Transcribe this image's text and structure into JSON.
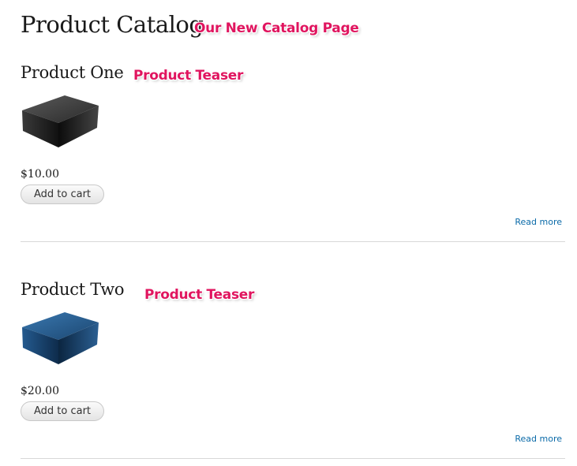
{
  "page": {
    "title": "Product Catalog",
    "title_annotation": "Our New Catalog Page"
  },
  "colors": {
    "annotation": "#e0155f",
    "link": "#0a6aa8",
    "divider": "#d8d8d8"
  },
  "products": [
    {
      "name": "Product One",
      "annotation": "Product Teaser",
      "image_icon": "black-box-image",
      "image_color": "#2b2b2b",
      "price": "$10.00",
      "cart_label": "Add to cart",
      "read_more": "Read more"
    },
    {
      "name": "Product Two",
      "annotation": "Product Teaser",
      "image_icon": "blue-box-image",
      "image_color": "#1d4a78",
      "price": "$20.00",
      "cart_label": "Add to cart",
      "read_more": "Read more"
    }
  ]
}
